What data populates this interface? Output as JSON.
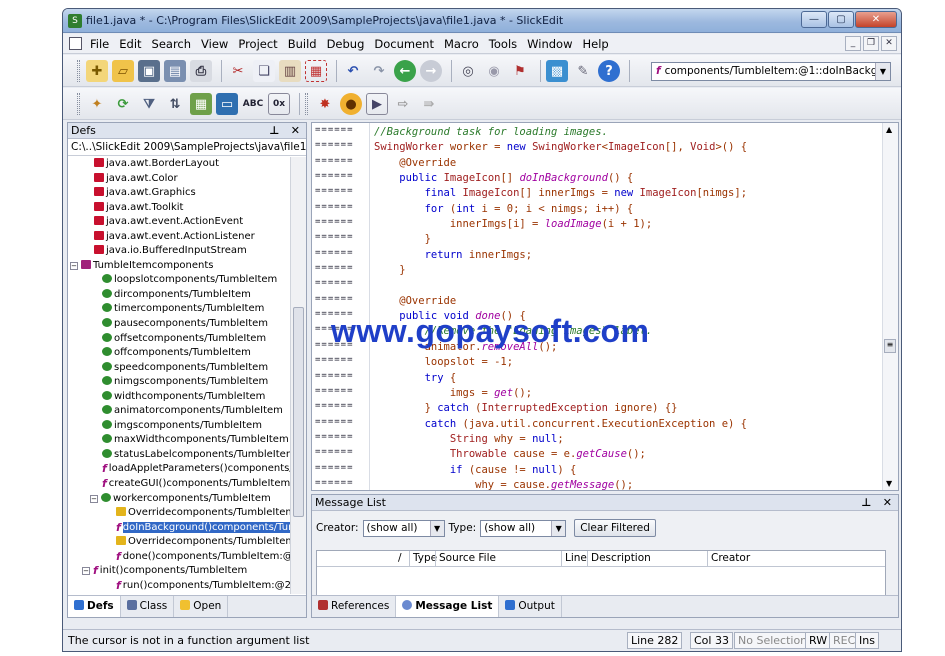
{
  "window": {
    "title": "file1.java * - C:\\Program Files\\SlickEdit 2009\\SampleProjects\\java\\file1.java * - SlickEdit"
  },
  "menubar": {
    "items": [
      "File",
      "Edit",
      "Search",
      "View",
      "Project",
      "Build",
      "Debug",
      "Document",
      "Macro",
      "Tools",
      "Window",
      "Help"
    ]
  },
  "toolbar": {
    "function_selector": "components/TumbleItem:@1::doInBackground("
  },
  "defs": {
    "title": "Defs",
    "path": "C:\\..\\SlickEdit 2009\\SampleProjects\\java\\file1.java",
    "items": [
      {
        "label": "java.awt.BorderLayout",
        "icon": "import"
      },
      {
        "label": "java.awt.Color",
        "icon": "import"
      },
      {
        "label": "java.awt.Graphics",
        "icon": "import"
      },
      {
        "label": "java.awt.Toolkit",
        "icon": "import"
      },
      {
        "label": "java.awt.event.ActionEvent",
        "icon": "import"
      },
      {
        "label": "java.awt.event.ActionListener",
        "icon": "import"
      },
      {
        "label": "java.io.BufferedInputStream",
        "icon": "import"
      },
      {
        "label": "TumbleItemcomponents",
        "icon": "class"
      },
      {
        "label": "loopslotcomponents/TumbleItem",
        "icon": "member"
      },
      {
        "label": "dircomponents/TumbleItem",
        "icon": "member"
      },
      {
        "label": "timercomponents/TumbleItem",
        "icon": "member"
      },
      {
        "label": "pausecomponents/TumbleItem",
        "icon": "member"
      },
      {
        "label": "offsetcomponents/TumbleItem",
        "icon": "member"
      },
      {
        "label": "offcomponents/TumbleItem",
        "icon": "member"
      },
      {
        "label": "speedcomponents/TumbleItem",
        "icon": "member"
      },
      {
        "label": "nimgscomponents/TumbleItem",
        "icon": "member"
      },
      {
        "label": "widthcomponents/TumbleItem",
        "icon": "member"
      },
      {
        "label": "animatorcomponents/TumbleItem",
        "icon": "member"
      },
      {
        "label": "imgscomponents/TumbleItem",
        "icon": "member"
      },
      {
        "label": "maxWidthcomponents/TumbleItem",
        "icon": "member"
      },
      {
        "label": "statusLabelcomponents/TumbleItem",
        "icon": "member"
      },
      {
        "label": "loadAppletParameters()components/Tu",
        "icon": "function"
      },
      {
        "label": "createGUI()components/TumbleItem",
        "icon": "function"
      },
      {
        "label": "workercomponents/TumbleItem",
        "icon": "member"
      },
      {
        "label": "Overridecomponents/TumbleItem:@",
        "icon": "override"
      },
      {
        "label": "doInBackground()components/Tumb",
        "icon": "function"
      },
      {
        "label": "Overridecomponents/TumbleItem:@",
        "icon": "override"
      },
      {
        "label": "done()components/TumbleItem:@1",
        "icon": "function"
      },
      {
        "label": "init()components/TumbleItem",
        "icon": "function"
      },
      {
        "label": "run()components/TumbleItem:@2",
        "icon": "function"
      }
    ],
    "tabs": [
      "Defs",
      "Class",
      "Open"
    ]
  },
  "editor": {
    "gutter_marker": "======",
    "lines": [
      "//Background task for loading images.",
      "SwingWorker worker = new SwingWorker<ImageIcon[], Void>() {",
      "    @Override",
      "    public ImageIcon[] doInBackground() {",
      "        final ImageIcon[] innerImgs = new ImageIcon[nimgs];",
      "        for (int i = 0; i < nimgs; i++) {",
      "            innerImgs[i] = loadImage(i + 1);",
      "        }",
      "        return innerImgs;",
      "    }",
      "",
      "    @Override",
      "    public void done() {",
      "        //Remove the \"Loading images\" label.",
      "        animator.removeAll();",
      "        loopslot = -1;",
      "        try {",
      "            imgs = get();",
      "        } catch (InterruptedException ignore) {}",
      "        catch (java.util.concurrent.ExecutionException e) {",
      "            String why = null;",
      "            Throwable cause = e.getCause();",
      "            if (cause != null) {",
      "                why = cause.getMessage();"
    ]
  },
  "watermark": "www.gopaysoft.com",
  "message_list": {
    "title": "Message List",
    "creator_label": "Creator:",
    "creator_value": "(show all)",
    "type_label": "Type:",
    "type_value": "(show all)",
    "clear_button": "Clear Filtered",
    "columns": [
      "/",
      "Type",
      "Source File",
      "Line",
      "Description",
      "Creator"
    ],
    "tabs": [
      "References",
      "Message List",
      "Output"
    ]
  },
  "status": {
    "message": "The cursor is not in a function argument list",
    "line": "Line 282",
    "col": "Col 33",
    "selection": "No Selection",
    "rw": "RW",
    "rec": "REC",
    "ins": "Ins"
  }
}
